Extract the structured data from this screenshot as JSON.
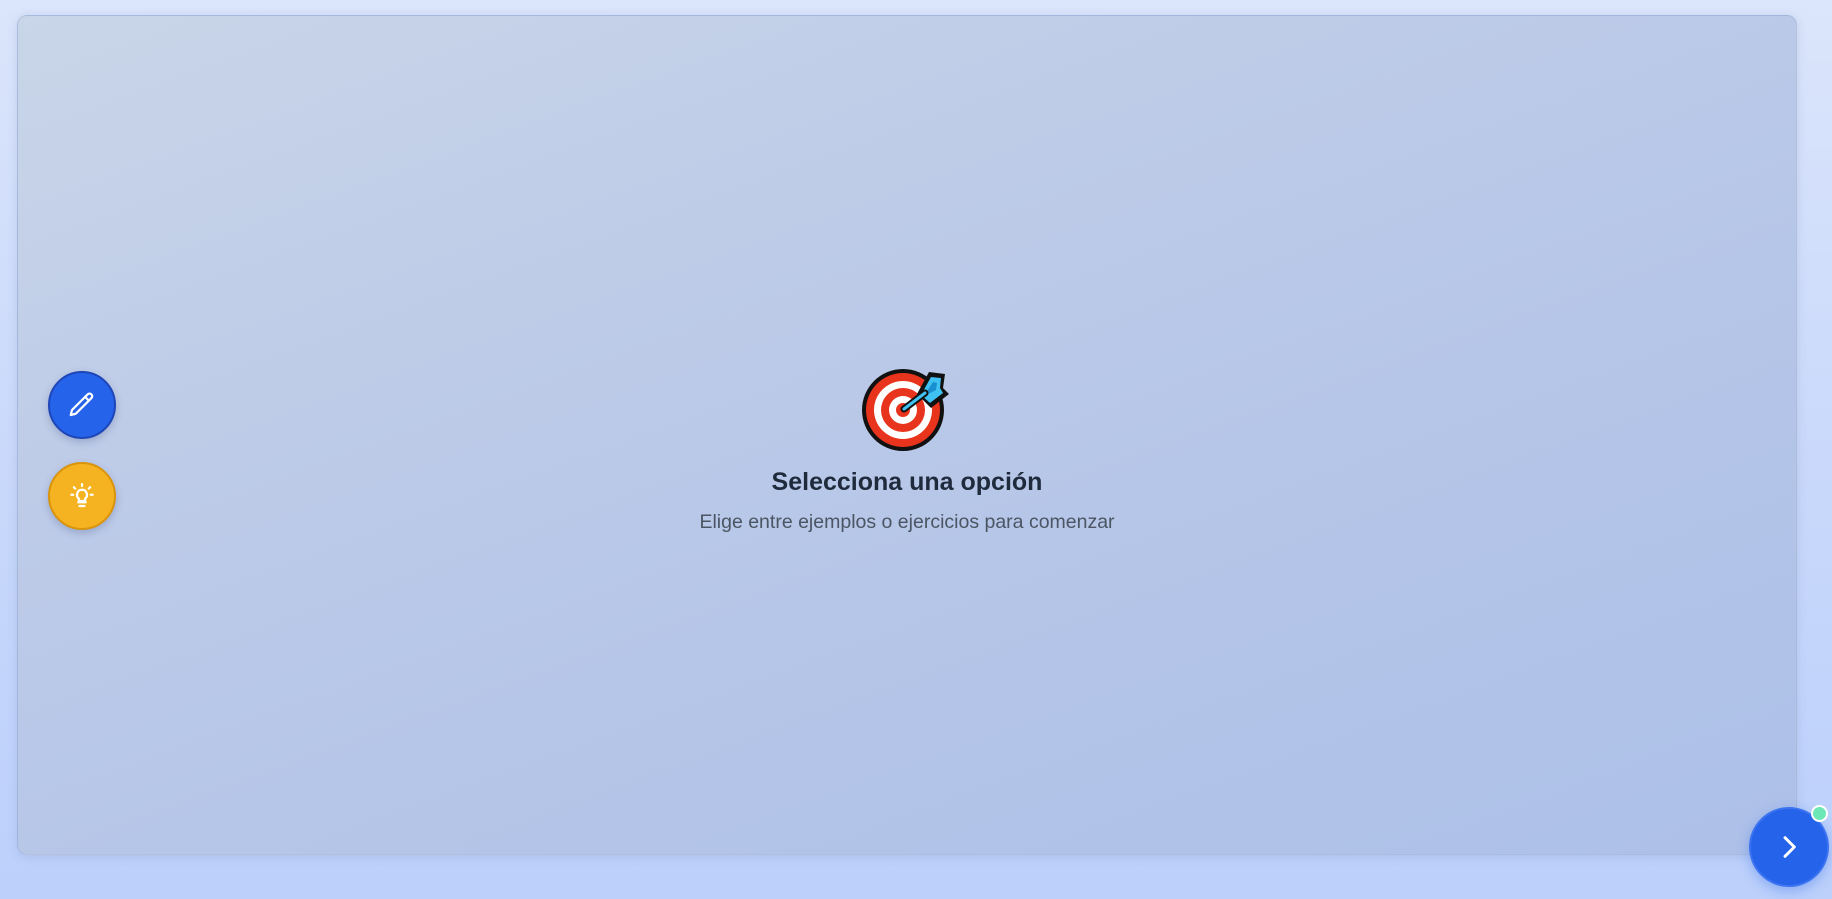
{
  "empty_state": {
    "icon": "direct-hit-target-icon",
    "title": "Selecciona una opción",
    "subtitle": "Elige entre ejemplos o ejercicios para comenzar"
  },
  "side_actions": [
    {
      "icon": "pencil-icon",
      "color": "#2563eb"
    },
    {
      "icon": "lightbulb-icon",
      "color": "#f5b321"
    }
  ],
  "next_button": {
    "icon": "chevron-right-icon",
    "color": "#2563eb"
  },
  "status_indicator": {
    "color": "#6ee7b7"
  }
}
